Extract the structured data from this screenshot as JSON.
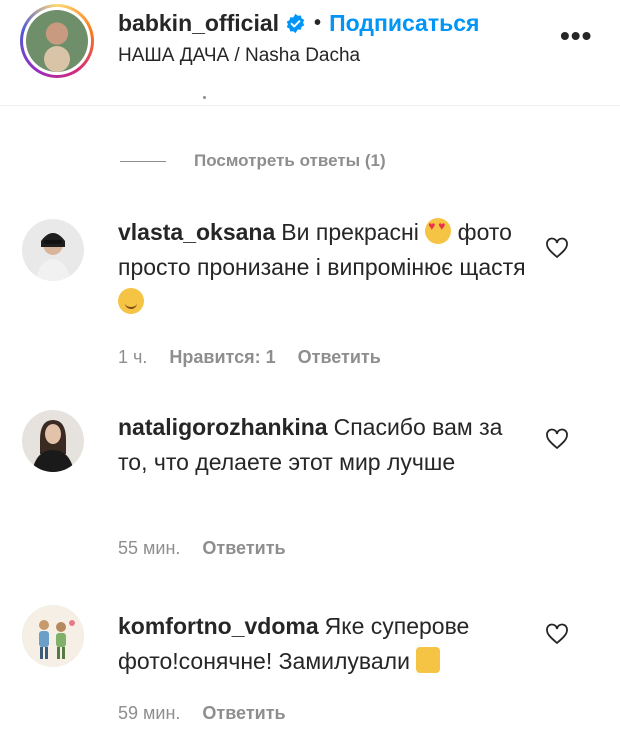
{
  "header": {
    "username": "babkin_official",
    "follow_label": "Подписаться",
    "separator": "•",
    "subtitle": "НАША ДАЧА / Nasha Dacha",
    "more_label": "•••"
  },
  "view_replies": "Посмотреть ответы (1)",
  "comments": [
    {
      "username": "vlasta_oksana",
      "text_part1": "Ви прекрасні",
      "text_part2": "фото просто пронизане і випромінює щастя",
      "time": "1 ч.",
      "likes": "Нравится: 1",
      "reply": "Ответить"
    },
    {
      "username": "natali­gorozhankina",
      "text": "Спасибо вам за то, что делаете этот мир лучше",
      "time": "55 мин.",
      "reply": "Ответить"
    },
    {
      "username": "komfortno_vdoma",
      "text": "Яке суперове фото!сонячне! Замилували",
      "time": "59 мин.",
      "reply": "Ответить"
    }
  ],
  "colors": {
    "link_blue": "#0095f6",
    "text": "#262626",
    "muted": "#8e8e8e"
  }
}
